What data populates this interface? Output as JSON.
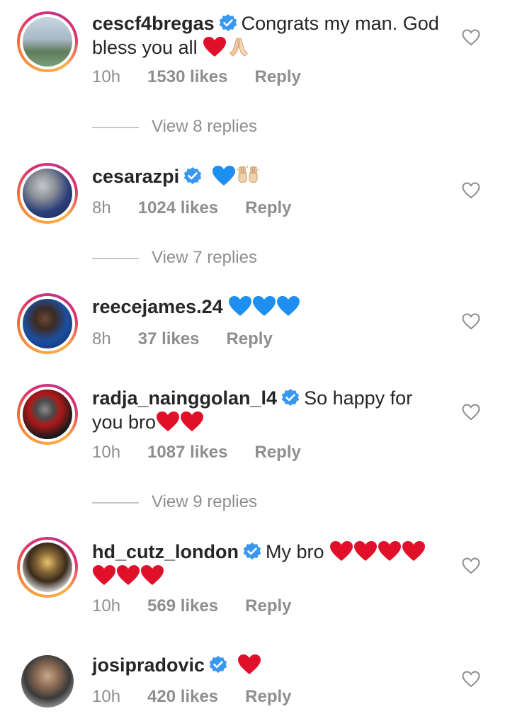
{
  "comments": [
    {
      "username": "cescf4bregas",
      "verified": true,
      "text": "Congrats my man. God bless you all",
      "emojis": [
        "red-heart",
        "folded-hands"
      ],
      "time": "10h",
      "likes": "1530 likes",
      "reply": "Reply",
      "view_replies": "View 8 replies"
    },
    {
      "username": "cesarazpi",
      "verified": true,
      "text": "",
      "emojis": [
        "blue-heart",
        "raising-hands"
      ],
      "time": "8h",
      "likes": "1024 likes",
      "reply": "Reply",
      "view_replies": "View 7 replies"
    },
    {
      "username": "reecejames.24",
      "verified": false,
      "text": "",
      "emojis": [
        "blue-heart",
        "blue-heart",
        "blue-heart"
      ],
      "time": "8h",
      "likes": "37 likes",
      "reply": "Reply",
      "view_replies": ""
    },
    {
      "username": "radja_nainggolan_l4",
      "verified": true,
      "text": "So happy for you bro",
      "emojis": [
        "red-heart",
        "red-heart"
      ],
      "time": "10h",
      "likes": "1087 likes",
      "reply": "Reply",
      "view_replies": "View 9 replies"
    },
    {
      "username": "hd_cutz_london",
      "verified": true,
      "text": "My bro",
      "emojis": [
        "red-heart",
        "red-heart",
        "red-heart",
        "red-heart",
        "red-heart",
        "red-heart",
        "red-heart"
      ],
      "time": "10h",
      "likes": "569 likes",
      "reply": "Reply",
      "view_replies": ""
    },
    {
      "username": "josipradovic",
      "verified": true,
      "text": "",
      "emojis": [
        "red-heart"
      ],
      "time": "10h",
      "likes": "420 likes",
      "reply": "Reply",
      "view_replies": ""
    }
  ],
  "colors": {
    "text": "#262626",
    "muted": "#8e8e8e",
    "verified": "#3897f0",
    "red_heart": "#e0102a",
    "blue_heart": "#1d8ff0"
  }
}
